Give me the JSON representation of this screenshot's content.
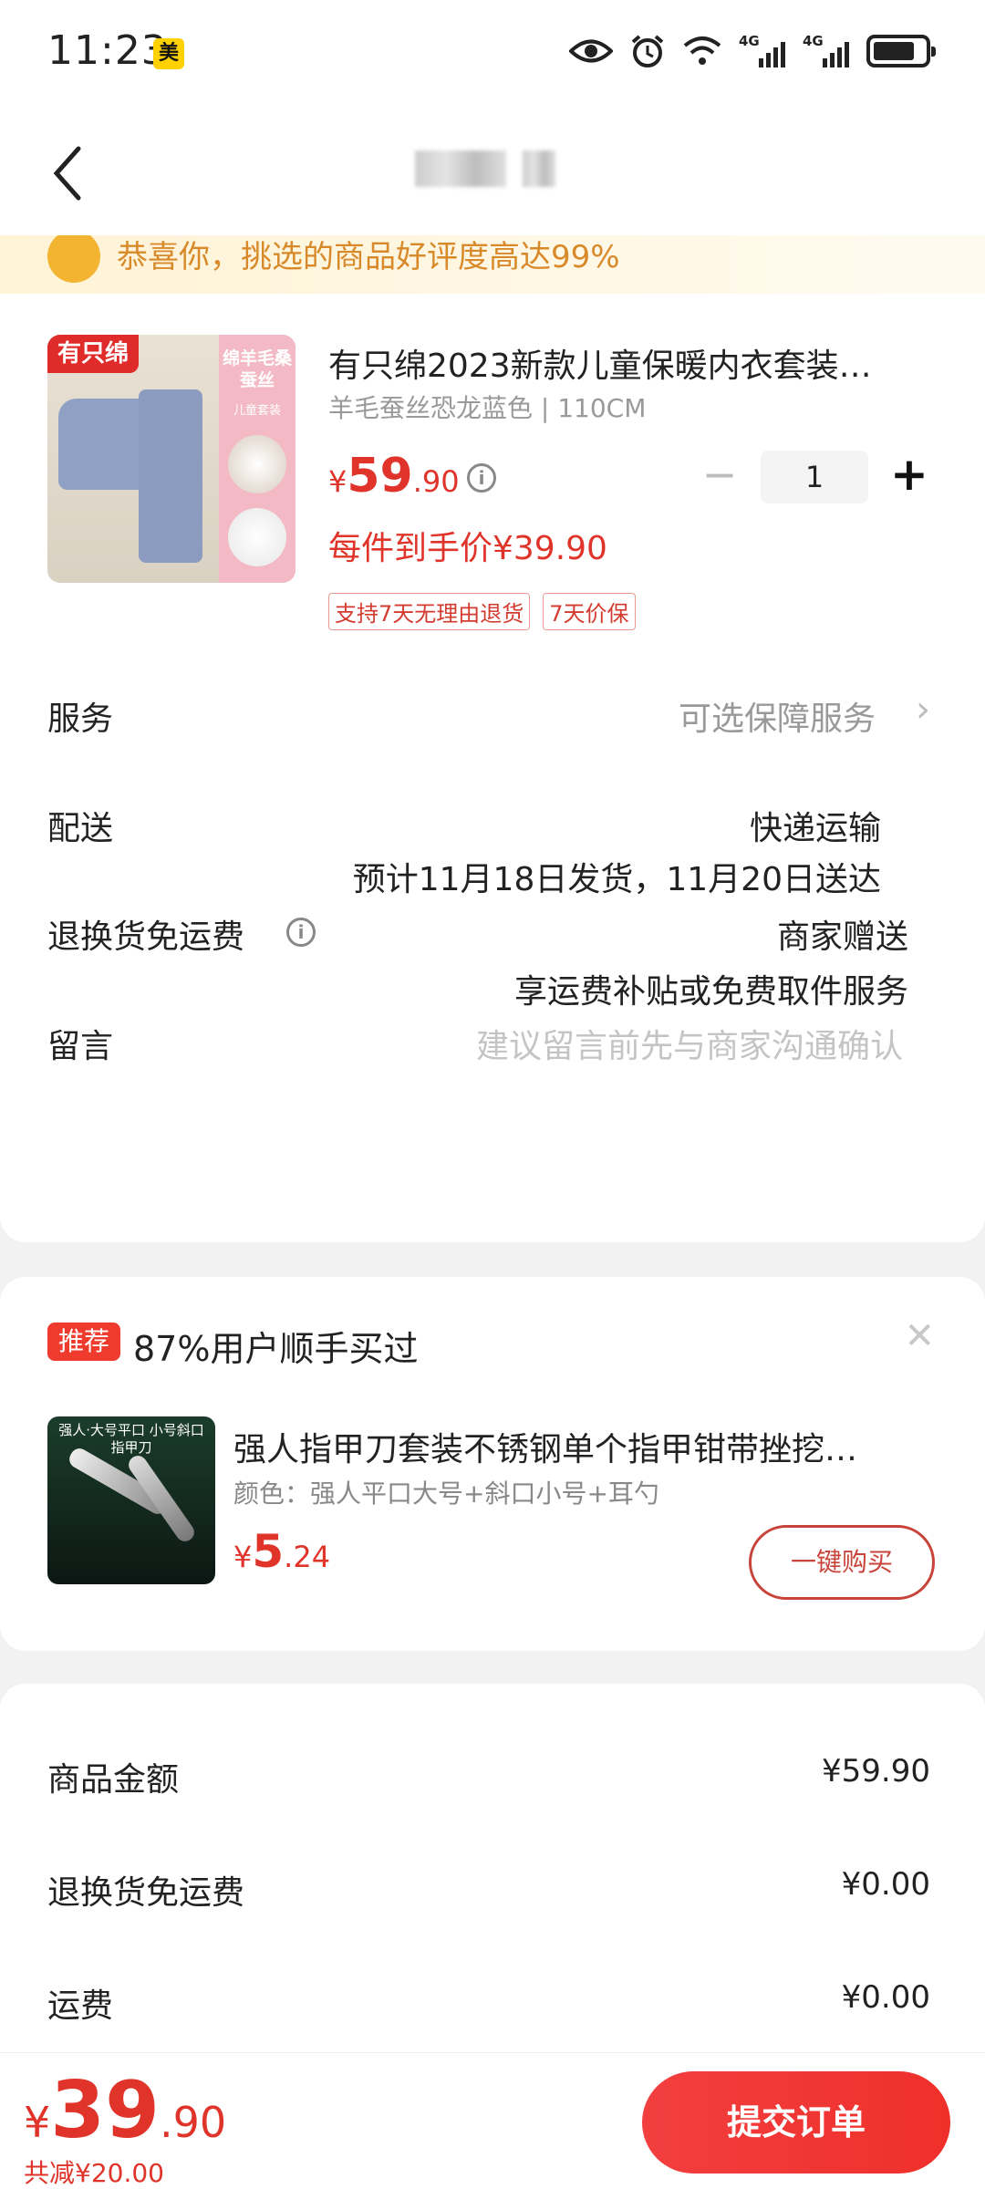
{
  "status_bar": {
    "time": "11:23",
    "app_badge": "美",
    "network_1": "4G",
    "network_2": "4G"
  },
  "notice": {
    "text": "恭喜你，挑选的商品好评度高达99%"
  },
  "product": {
    "image_brand_label": "有只绵",
    "image_side_label": "绵羊毛桑蚕丝",
    "image_side_sub": "儿童套装",
    "title": "有只绵2023新款儿童保暖内衣套装…",
    "spec": "羊毛蚕丝恐龙蓝色 | 110CM",
    "price_symbol": "¥",
    "price_int": "59",
    "price_dec": ".90",
    "quantity": "1",
    "each_price": "每件到手价¥39.90",
    "tags": [
      "支持7天无理由退货",
      "7天价保"
    ]
  },
  "rows": {
    "service_label": "服务",
    "service_value": "可选保障服务",
    "delivery_label": "配送",
    "delivery_method": "快递运输",
    "delivery_eta": "预计11月18日发货，11月20日送达",
    "return_label": "退换货免运费",
    "return_value": "商家赠送",
    "return_desc": "享运费补贴或免费取件服务",
    "message_label": "留言",
    "message_placeholder": "建议留言前先与商家沟通确认"
  },
  "recommendation": {
    "badge": "推荐",
    "title": "87%用户顺手买过",
    "image_text": "强人·大号平口 小号斜口指甲刀",
    "product_title": "强人指甲刀套装不锈钢单个指甲钳带挫挖…",
    "spec": "颜色：强人平口大号+斜口小号+耳勺",
    "price_symbol": "¥",
    "price_int": "5",
    "price_dec": ".24",
    "buy_button": "一键购买"
  },
  "summary": {
    "items": [
      {
        "label": "商品金额",
        "value": "¥59.90"
      },
      {
        "label": "退换货免运费",
        "value": "¥0.00"
      },
      {
        "label": "运费",
        "value": "¥0.00"
      }
    ]
  },
  "bottom": {
    "total_symbol": "¥",
    "total_int": "39",
    "total_dec": ".90",
    "saved": "共减¥20.00",
    "submit": "提交订单"
  }
}
